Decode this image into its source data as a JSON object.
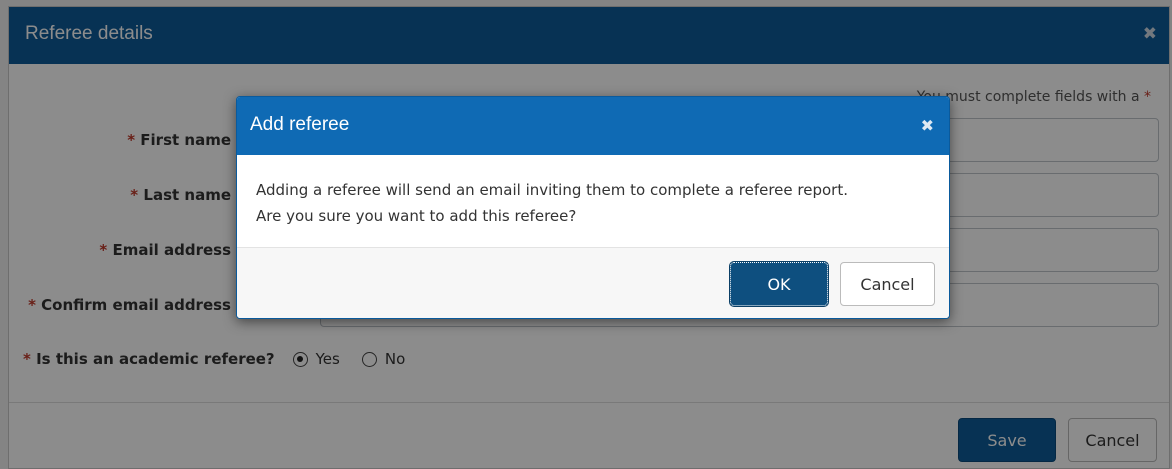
{
  "panel": {
    "title": "Referee details",
    "close_glyph": "✖",
    "required_note": "You must complete fields with a",
    "required_star": "*",
    "fields": [
      {
        "label": "First name"
      },
      {
        "label": "Last name"
      },
      {
        "label": "Email address"
      },
      {
        "label": "Confirm email address"
      }
    ],
    "academic_question": "Is this an academic referee?",
    "options": [
      {
        "label": "Yes",
        "selected": true
      },
      {
        "label": "No",
        "selected": false
      }
    ],
    "save_label": "Save",
    "cancel_label": "Cancel"
  },
  "modal": {
    "title": "Add referee",
    "close_glyph": "✖",
    "message_line1": "Adding a referee will send an email inviting them to complete a referee report.",
    "message_line2": "Are you sure you want to add this referee?",
    "ok_label": "OK",
    "cancel_label": "Cancel"
  },
  "colors": {
    "header_bg": "#0e5c99",
    "modal_header_bg": "#0f6ab4",
    "primary_button": "#0e5c99",
    "required_star": "#c0392b"
  }
}
